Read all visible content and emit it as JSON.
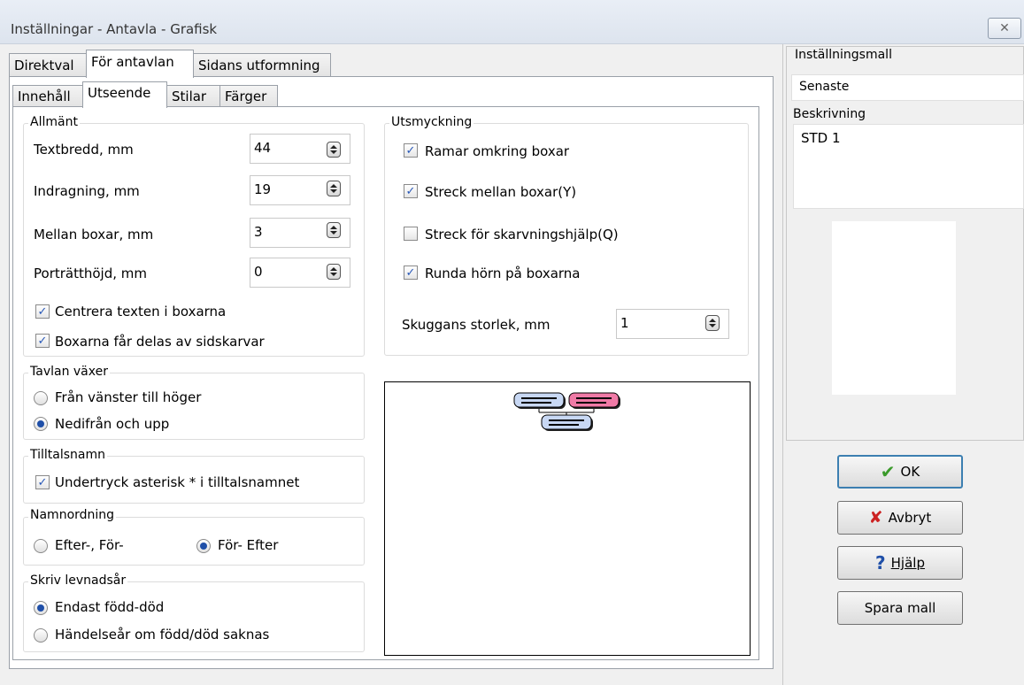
{
  "window": {
    "title": "Inställningar - Antavla - Grafisk"
  },
  "tabs_main": [
    "Direktval",
    "För antavlan",
    "Sidans utformning"
  ],
  "tabs_sub": [
    "Innehåll",
    "Utseende",
    "Stilar",
    "Färger"
  ],
  "allmant": {
    "label": "Allmänt",
    "textbredd": {
      "label": "Textbredd, mm",
      "value": "44"
    },
    "indragning": {
      "label": "Indragning, mm",
      "value": "19"
    },
    "mellan_boxar": {
      "label": "Mellan boxar, mm",
      "value": "3"
    },
    "portratthojd": {
      "label": "Porträtthöjd, mm",
      "value": "0"
    },
    "centrera": {
      "label": "Centrera texten i boxarna",
      "checked": true
    },
    "delas": {
      "label": "Boxarna får delas av sidskarvar",
      "checked": true
    }
  },
  "tavlan": {
    "label": "Tavlan växer",
    "opt1": "Från vänster till höger",
    "opt2": "Nedifrån och upp",
    "selected": "opt2"
  },
  "tilltal": {
    "label": "Tilltalsnamn",
    "undertryck": {
      "label": "Undertryck asterisk * i tilltalsnamnet",
      "checked": true
    }
  },
  "namnordning": {
    "label": "Namnordning",
    "opt1": "Efter-, För-",
    "opt2": "För- Efter",
    "selected": "opt2"
  },
  "levnadsar": {
    "label": "Skriv levnadsår",
    "opt1": "Endast född-död",
    "opt2": "Händelseår om född/död saknas",
    "selected": "opt1"
  },
  "utsmyckning": {
    "label": "Utsmyckning",
    "ramar": {
      "label": "Ramar omkring boxar",
      "checked": true
    },
    "streck": {
      "label": "Streck mellan boxar(Y)",
      "checked": true
    },
    "skarvning": {
      "label": "Streck för skarvningshjälp(Q)",
      "checked": false
    },
    "runda": {
      "label": "Runda hörn på boxarna",
      "checked": true
    },
    "skugga": {
      "label": "Skuggans storlek, mm",
      "value": "1"
    }
  },
  "side": {
    "mall_label": "Inställningsmall",
    "mall_value": "Senaste",
    "beskr_label": "Beskrivning",
    "beskr_value": "STD 1"
  },
  "buttons": {
    "ok": "OK",
    "avbryt": "Avbryt",
    "hjalp": "Hjälp",
    "spara": "Spara mall"
  },
  "colors": {
    "box_blue": "#c8d8f4",
    "box_pink": "#f07aa6",
    "ok_green": "#3a9a2a",
    "cancel_red": "#cc2222",
    "help_blue": "#1f4fa8"
  }
}
